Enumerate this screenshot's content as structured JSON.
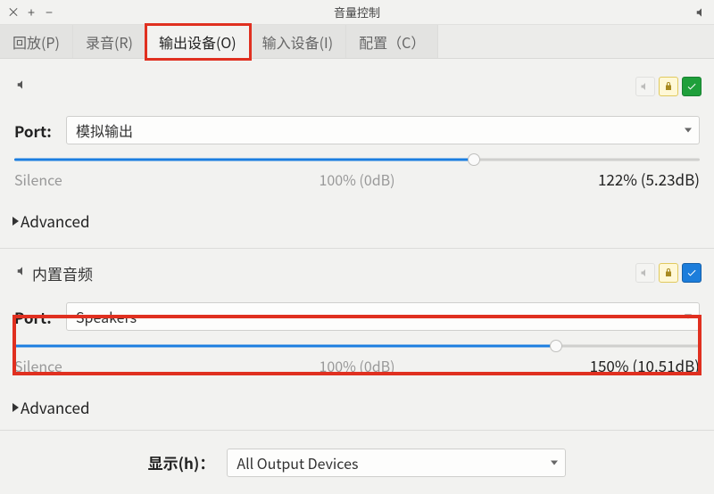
{
  "window": {
    "title": "音量控制"
  },
  "tabs": {
    "playback": "回放(P)",
    "recording": "录音(R)",
    "output": "输出设备(O)",
    "input": "输入设备(I)",
    "config": "配置（C）"
  },
  "device1": {
    "port_label": "Port:",
    "port_value": "模拟输出",
    "silence_label": "Silence",
    "center_label": "100% (0dB)",
    "value_label": "122% (5.23dB)",
    "advanced_label": "Advanced",
    "slider_percent": 67
  },
  "device2": {
    "name": "内置音频",
    "port_label": "Port:",
    "port_value": "Speakers",
    "silence_label": "Silence",
    "center_label": "100% (0dB)",
    "value_label": "150% (10.51dB)",
    "advanced_label": "Advanced",
    "slider_percent": 79
  },
  "footer": {
    "show_label": "显示(h)：",
    "show_value": "All Output Devices"
  }
}
